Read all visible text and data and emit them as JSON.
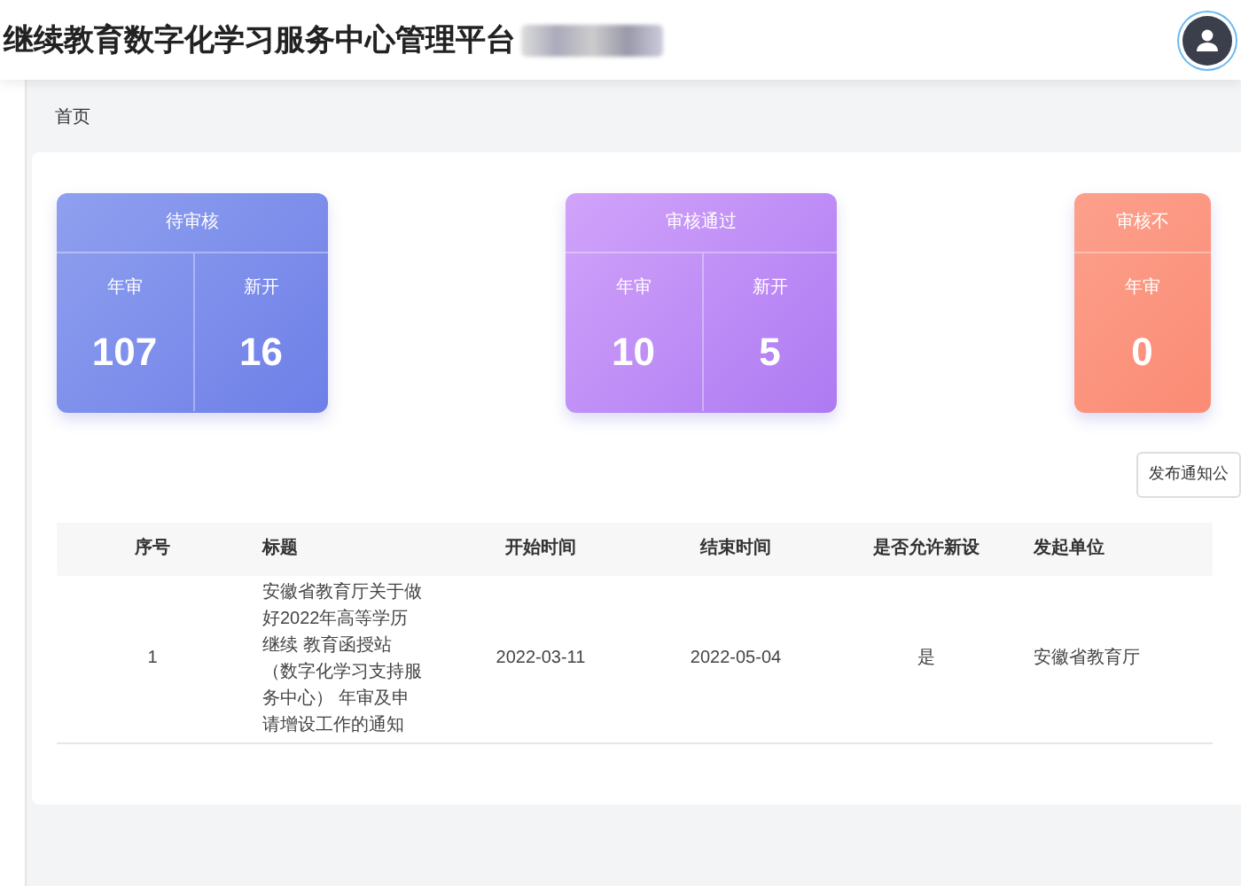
{
  "header": {
    "title": "继续教育数字化学习服务中心管理平台"
  },
  "breadcrumb": "首页",
  "stat_cards": [
    {
      "kind": "pending",
      "title": "待审核",
      "items": [
        {
          "label": "年审",
          "value": "107"
        },
        {
          "label": "新开",
          "value": "16"
        }
      ]
    },
    {
      "kind": "approved",
      "title": "审核通过",
      "items": [
        {
          "label": "年审",
          "value": "10"
        },
        {
          "label": "新开",
          "value": "5"
        }
      ]
    },
    {
      "kind": "rejected",
      "title": "审核不",
      "items": [
        {
          "label": "年审",
          "value": "0"
        }
      ]
    }
  ],
  "publish_button": "发布通知公",
  "table": {
    "columns": [
      "序号",
      "标题",
      "开始时间",
      "结束时间",
      "是否允许新设",
      "发起单位"
    ],
    "rows": [
      [
        "1",
        "安徽省教育厅关于做好2022年高等学历继续 教育函授站（数字化学习支持服务中心） 年审及申请增设工作的通知",
        "2022-03-11",
        "2022-05-04",
        "是",
        "安徽省教育厅"
      ]
    ]
  }
}
